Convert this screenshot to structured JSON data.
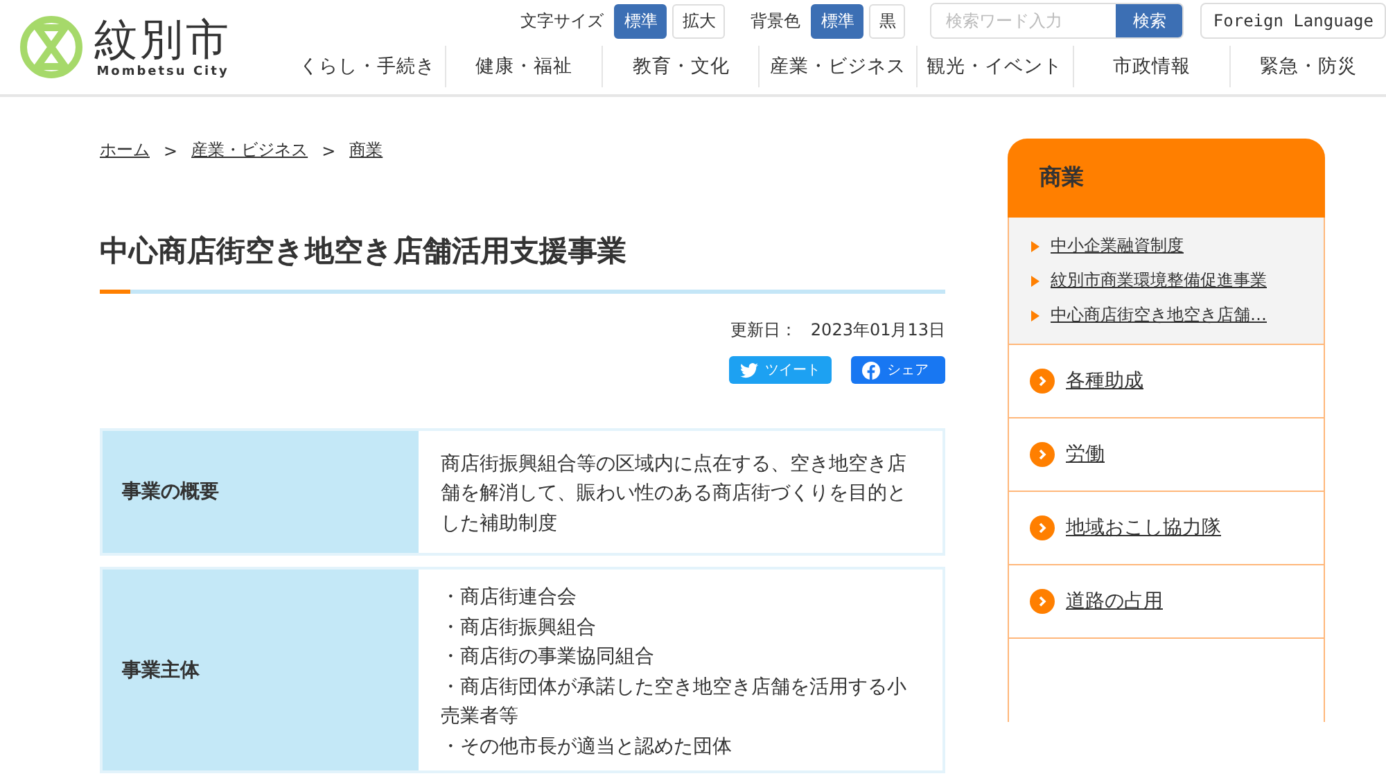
{
  "header": {
    "logo": {
      "name": "紋別市",
      "sub": "Mombetsu City"
    },
    "font_size": {
      "label": "文字サイズ",
      "options": [
        {
          "label": "標準",
          "selected": true
        },
        {
          "label": "拡大",
          "selected": false
        }
      ]
    },
    "bg_color": {
      "label": "背景色",
      "options": [
        {
          "label": "標準",
          "selected": true
        },
        {
          "label": "黒",
          "selected": false
        }
      ]
    },
    "search": {
      "placeholder": "検索ワード入力",
      "button": "検索"
    },
    "foreign_language": "Foreign Language",
    "nav": [
      "くらし・手続き",
      "健康・福祉",
      "教育・文化",
      "産業・ビジネス",
      "観光・イベント",
      "市政情報",
      "緊急・防災"
    ]
  },
  "breadcrumb": [
    {
      "label": "ホーム"
    },
    {
      "label": "産業・ビジネス"
    },
    {
      "label": "商業"
    }
  ],
  "separator": ">",
  "page": {
    "title": "中心商店街空き地空き店舗活用支援事業",
    "updated_label": "更新日：",
    "updated": "2023年01月13日",
    "share": [
      {
        "kind": "twitter",
        "label": "ツイート"
      },
      {
        "kind": "facebook",
        "label": "シェア"
      }
    ],
    "table": [
      {
        "heading": "事業の概要",
        "lines": [
          "商店街振興組合等の区域内に点在する、空き地空き店舗を解消して、賑わい性のある商店街づくりを目的とした補助制度"
        ]
      },
      {
        "heading": "事業主体",
        "lines": [
          "・商店街連合会",
          "・商店街振興組合",
          "・商店街の事業協同組合",
          "・商店街団体が承諾した空き地空き店舗を活用する小売業者等",
          "・その他市長が適当と認めた団体"
        ]
      }
    ]
  },
  "sidebar": {
    "title": "商業",
    "sub_items": [
      "中小企業融資制度",
      "紋別市商業環境整備促進事業",
      "中心商店街空き地空き店舗…"
    ],
    "items": [
      "各種助成",
      "労働",
      "地域おこし協力隊",
      "道路の占用"
    ]
  }
}
